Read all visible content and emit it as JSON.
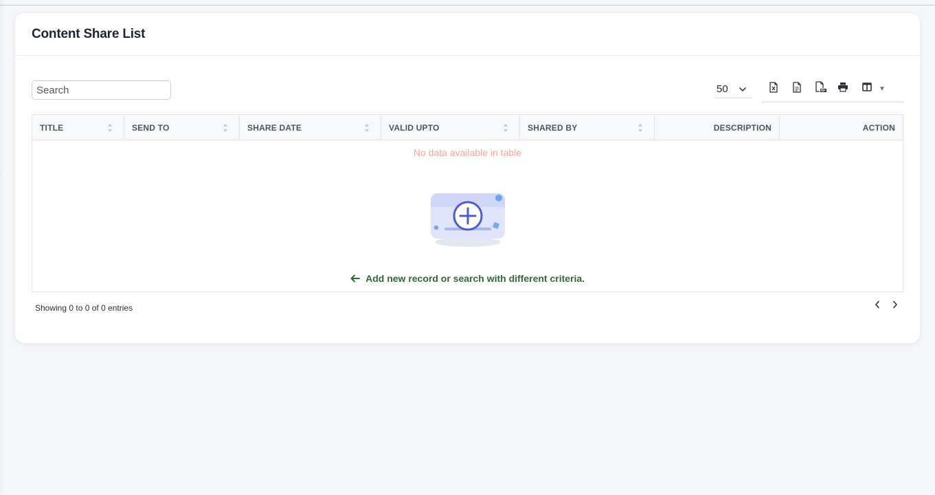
{
  "page": {
    "title": "Content Share List"
  },
  "search": {
    "placeholder": "Search",
    "value": ""
  },
  "page_size": {
    "selected": "50"
  },
  "export_tools": {
    "icons": [
      "excel-export-icon",
      "csv-export-icon",
      "pdf-export-icon",
      "print-icon",
      "column-visibility-icon"
    ]
  },
  "table": {
    "columns": [
      {
        "label": "TITLE",
        "sortable": true
      },
      {
        "label": "SEND TO",
        "sortable": true
      },
      {
        "label": "SHARE DATE",
        "sortable": true
      },
      {
        "label": "VALID UPTO",
        "sortable": true
      },
      {
        "label": "SHARED BY",
        "sortable": true
      },
      {
        "label": "DESCRIPTION",
        "sortable": false
      },
      {
        "label": "ACTION",
        "sortable": false
      }
    ],
    "rows": [],
    "empty_message": "No data available in table",
    "empty_hint": "Add new record or search with different criteria."
  },
  "footer": {
    "info": "Showing 0 to 0 of 0 entries"
  },
  "colors": {
    "accent": "#4a5bd6",
    "empty_message": "#f4a3a3",
    "hint": "#2e6a35"
  }
}
